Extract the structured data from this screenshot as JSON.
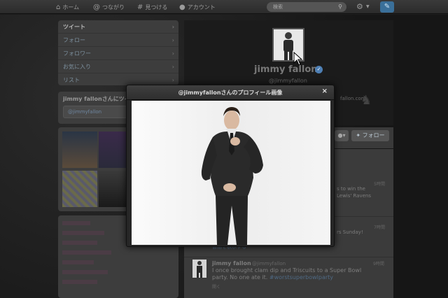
{
  "topbar": {
    "home": "ホーム",
    "connect": "つながり",
    "discover": "見つける",
    "account": "アカウント",
    "search_placeholder": "検索",
    "home_icon": "home-icon",
    "connect_icon": "at-icon",
    "discover_icon": "hash-icon",
    "account_icon": "person-icon",
    "search_icon": "magnifier-icon",
    "gear_icon": "gear-icon",
    "compose_icon": "compose-icon"
  },
  "sidebar": {
    "items": [
      {
        "label": "ツイート"
      },
      {
        "label": "フォロー"
      },
      {
        "label": "フォロワー"
      },
      {
        "label": "お気に入り"
      },
      {
        "label": "リスト"
      }
    ],
    "tweet_to_title": "jimmy fallonさんにツイー",
    "tweet_to_value": "@jimmyfallon"
  },
  "profile": {
    "name": "jimmy fallon",
    "handle": "@jimmyfallon",
    "url_fragment": "fallon.com",
    "follow_label": "フォロー"
  },
  "tweets": [
    {
      "time": "5時間",
      "fragments": [
        "s to win the",
        "Lewis' Ravens"
      ]
    },
    {
      "time": "7時間",
      "fragments": [
        "rs Sunday!"
      ]
    },
    {
      "fragments": [
        "会話を表示する"
      ]
    },
    {
      "author": "jimmy fallon",
      "handle": "@jimmyfallon",
      "time": "9時間",
      "text_main": "I once brought clam dip and Triscuits to a Super Bowl party. No one ate it.",
      "text_tag": "#worstsuperbowlparty",
      "more": "開く"
    }
  ],
  "modal": {
    "title": "@jimmyfallonさんのプロフィール画像",
    "close_label": "×"
  },
  "colors": {
    "accent_blue": "#3a6f99",
    "link_blue": "#4f6a85",
    "verified_blue": "#4e7fb4"
  }
}
